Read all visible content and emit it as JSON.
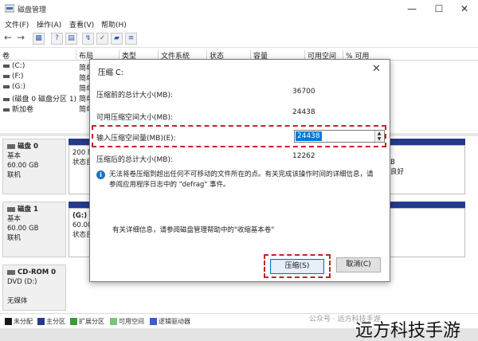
{
  "window": {
    "title": "磁盘管理",
    "controls": {
      "minimize": "—",
      "maximize": "☐",
      "close": "✕"
    }
  },
  "menu": [
    "文件(F)",
    "操作(A)",
    "查看(V)",
    "帮助(H)"
  ],
  "table": {
    "headers": [
      "卷",
      "布局",
      "类型",
      "文件系统",
      "状态",
      "容量",
      "可用空间",
      "% 可用"
    ],
    "rows": [
      {
        "volume": "(C:)",
        "layout": "简单"
      },
      {
        "volume": "(F:)",
        "layout": "简单"
      },
      {
        "volume": "(G:)",
        "layout": "简单"
      },
      {
        "volume": "(磁盘 0 磁盘分区 1)",
        "layout": "简单"
      },
      {
        "volume": "新加卷",
        "layout": "简单"
      }
    ]
  },
  "disks": [
    {
      "title": "磁盘 0",
      "lines": [
        "基本",
        "60.00 GB",
        "联机"
      ],
      "partition_lines": [
        "200 MB",
        "状态良"
      ],
      "right_lines": [
        "B",
        "良好"
      ]
    },
    {
      "title": "磁盘 1",
      "lines": [
        "基本",
        "60.00 GB",
        "联机"
      ],
      "partition_lines": [
        "(G:)",
        "60.00 G",
        "状态良"
      ],
      "right_lines": []
    },
    {
      "title": "CD-ROM 0",
      "lines": [
        "DVD (D:)",
        "",
        "无媒体"
      ],
      "partition_lines": [],
      "right_lines": []
    }
  ],
  "legend": [
    {
      "label": "未分配",
      "color": "#1a1a1a"
    },
    {
      "label": "主分区",
      "color": "#253a8c"
    },
    {
      "label": "扩展分区",
      "color": "#3c9a3c"
    },
    {
      "label": "可用空间",
      "color": "#7cc47c"
    },
    {
      "label": "逻辑驱动器",
      "color": "#3a5fcd"
    }
  ],
  "dialog": {
    "title": "压缩 C:",
    "close": "✕",
    "total_before_label": "压缩前的总计大小(MB):",
    "total_before_value": "36700",
    "available_label": "可用压缩空间大小(MB):",
    "available_value": "24438",
    "input_label": "输入压缩空间量(MB)(E):",
    "input_value": "24438",
    "total_after_label": "压缩后的总计大小(MB):",
    "total_after_value": "12262",
    "info_line1": "无法将卷压缩到超出任何不可移动的文件所在的点。有关完成该操作时间的详细信息，请",
    "info_line2": "参阅应用程序日志中的 \"defrag\" 事件。",
    "help_text": "有关详细信息，请参阅磁盘管理帮助中的\"收缩基本卷\"",
    "ok_button": "压缩(S)",
    "cancel_button": "取消(C)"
  },
  "watermark": {
    "small": "公众号 · 远方科技手游",
    "big": "远方科技手游"
  },
  "colors": {
    "accent": "#0078d7",
    "highlight": "#c0252b",
    "primary_partition": "#253a8c"
  }
}
